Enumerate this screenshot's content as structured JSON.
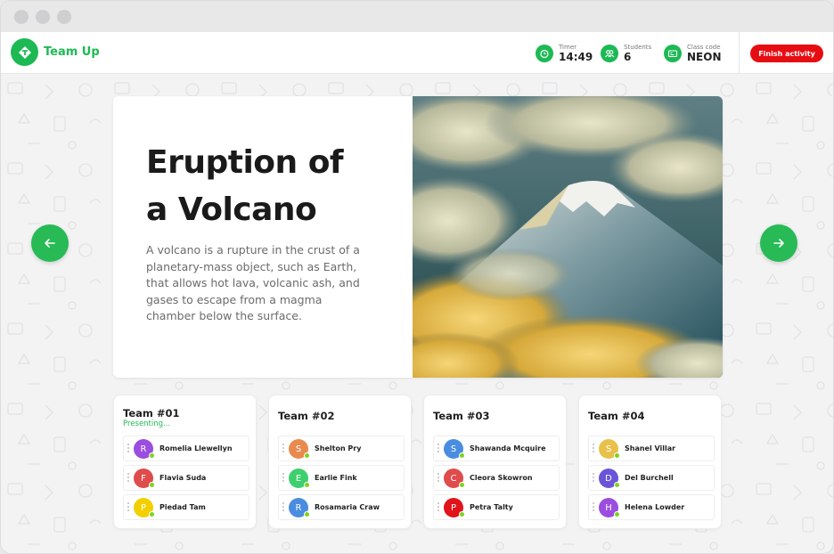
{
  "app": {
    "name": "Team Up"
  },
  "header": {
    "stats": [
      {
        "label": "Timer",
        "value": "14:49",
        "icon": "alarm-clock-icon"
      },
      {
        "label": "Students",
        "value": "6",
        "icon": "users-icon"
      },
      {
        "label": "Class code",
        "value": "NEON",
        "icon": "id-card-icon"
      }
    ],
    "finish_label": "Finish activity"
  },
  "slide": {
    "title_line1": "Eruption of",
    "title_line2": "a Volcano",
    "description": "A volcano is a rupture in the crust of a planetary-mass object, such as Earth, that allows hot lava, volcanic ash, and gases to escape from a magma chamber below the surface."
  },
  "teams": [
    {
      "name": "Team #01",
      "status": "Presenting...",
      "members": [
        {
          "initial": "R",
          "name": "Romelia Llewellyn",
          "color": "#9b4de0"
        },
        {
          "initial": "F",
          "name": "Flavia Suda",
          "color": "#e04b4b"
        },
        {
          "initial": "P",
          "name": "Piedad Tam",
          "color": "#f2d000"
        }
      ]
    },
    {
      "name": "Team #02",
      "status": "",
      "members": [
        {
          "initial": "S",
          "name": "Shelton Pry",
          "color": "#e98a4f"
        },
        {
          "initial": "E",
          "name": "Earlie Fink",
          "color": "#3ecf6e"
        },
        {
          "initial": "R",
          "name": "Rosamaria Craw",
          "color": "#4a8de0"
        }
      ]
    },
    {
      "name": "Team #03",
      "status": "",
      "members": [
        {
          "initial": "S",
          "name": "Shawanda Mcquire",
          "color": "#4a8de0"
        },
        {
          "initial": "C",
          "name": "Cleora Skowron",
          "color": "#e04b4b"
        },
        {
          "initial": "P",
          "name": "Petra Talty",
          "color": "#e0141a"
        }
      ]
    },
    {
      "name": "Team #04",
      "status": "",
      "members": [
        {
          "initial": "S",
          "name": "Shanel Villar",
          "color": "#e8c14a"
        },
        {
          "initial": "D",
          "name": "Del Burchell",
          "color": "#6a55d8"
        },
        {
          "initial": "H",
          "name": "Helena Lowder",
          "color": "#9b4de0"
        }
      ]
    }
  ],
  "colors": {
    "brand": "#1db954",
    "danger": "#e60d12",
    "nav": "#27ba55"
  }
}
